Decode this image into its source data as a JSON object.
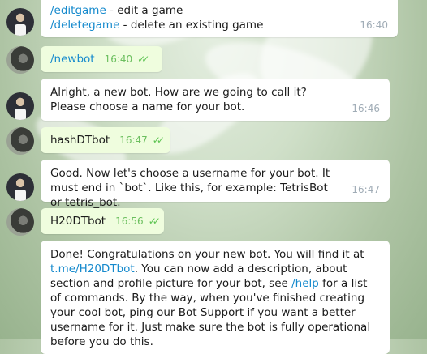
{
  "messages": [
    {
      "sender": "botfather",
      "lines": [
        {
          "link": "/editgame",
          "text": " - edit a game"
        },
        {
          "link": "/deletegame",
          "text": " - delete an existing game"
        }
      ],
      "time": "16:40"
    },
    {
      "sender": "user",
      "text": "/newbot",
      "time": "16:40",
      "read": true
    },
    {
      "sender": "botfather",
      "text": "Alright, a new bot. How are we going to call it? Please choose a name for your bot.",
      "time": "16:46"
    },
    {
      "sender": "user",
      "text": "hashDTbot",
      "time": "16:47",
      "read": true
    },
    {
      "sender": "botfather",
      "text": "Good. Now let's choose a username for your bot. It must end in `bot`. Like this, for example: TetrisBot or tetris_bot.",
      "time": "16:47"
    },
    {
      "sender": "user",
      "text": "H20DTbot",
      "time": "16:56",
      "read": true
    },
    {
      "sender": "botfather",
      "parts": {
        "p1": "Done! Congratulations on your new bot. You will find it at ",
        "link1": "t.me/H20DTbot",
        "p2": ". You can now add a description, about section and profile picture for your bot, see ",
        "link2": "/help",
        "p3": " for a list of commands. By the way, when you've finished creating your cool bot, ping our Bot Support if you want a better username for it. Just make sure the bot is fully operational before you do this."
      }
    }
  ],
  "colors": {
    "incoming_bubble": "#ffffff",
    "outgoing_bubble": "#effdde",
    "link": "#168acd",
    "read_checks": "#5dc452"
  }
}
